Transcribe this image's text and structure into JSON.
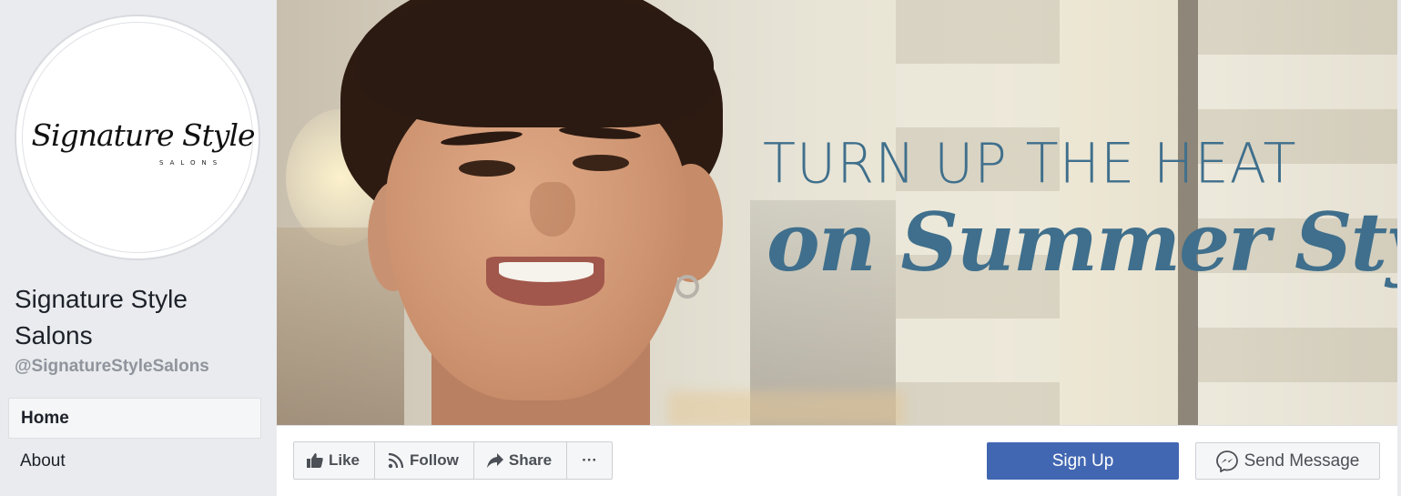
{
  "profile": {
    "logo_script": "Signature Style",
    "logo_sub": "SALONS",
    "name": "Signature Style Salons",
    "handle": "@SignatureStyleSalons"
  },
  "nav": {
    "items": [
      {
        "label": "Home",
        "active": true
      },
      {
        "label": "About",
        "active": false
      }
    ]
  },
  "cover": {
    "line1": "TURN UP THE HEAT",
    "line2": "on Summer Style",
    "text_color": "#3f6f8c"
  },
  "actions": {
    "like": {
      "label": "Like",
      "icon": "thumbs-up-icon"
    },
    "follow": {
      "label": "Follow",
      "icon": "rss-icon"
    },
    "share": {
      "label": "Share",
      "icon": "share-arrow-icon"
    },
    "more": {
      "label": "···",
      "icon": "more-dots-icon"
    },
    "signup": {
      "label": "Sign Up",
      "color": "#4267b2"
    },
    "message": {
      "label": "Send Message",
      "icon": "messenger-icon"
    }
  }
}
